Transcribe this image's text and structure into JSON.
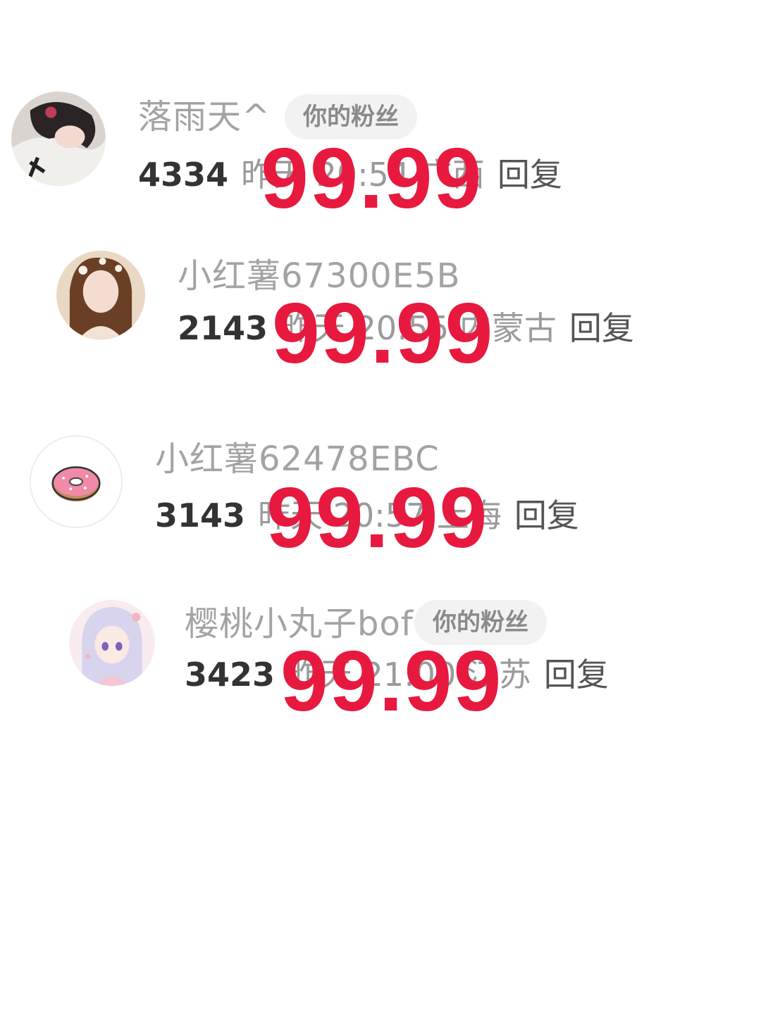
{
  "comments": [
    {
      "username": "落雨天^",
      "badge": "你的粉丝",
      "likes": "4334",
      "time_location": "昨天 20:54 广西",
      "reply": "回复",
      "price": "99.99",
      "avatar": "avatar-girl-lying-icon"
    },
    {
      "username": "小红薯67300E5B",
      "badge": "",
      "likes": "2143",
      "time_location": "昨天 20:55 内蒙古",
      "reply": "回复",
      "price": "99.99",
      "avatar": "avatar-girl-flowers-icon"
    },
    {
      "username": "小红薯62478EBC",
      "badge": "",
      "likes": "3143",
      "time_location": "昨天 20:57 上海",
      "reply": "回复",
      "price": "99.99",
      "avatar": "donut-icon"
    },
    {
      "username": "樱桃小丸子bof",
      "badge": "你的粉丝",
      "likes": "3423",
      "time_location": "昨天 21:00 江苏",
      "reply": "回复",
      "price": "99.99",
      "avatar": "anime-girl-avatar-icon"
    }
  ],
  "colors": {
    "price_red": "#e8193f",
    "username_gray": "#a3a3a3",
    "badge_bg": "#f2f2f2"
  }
}
